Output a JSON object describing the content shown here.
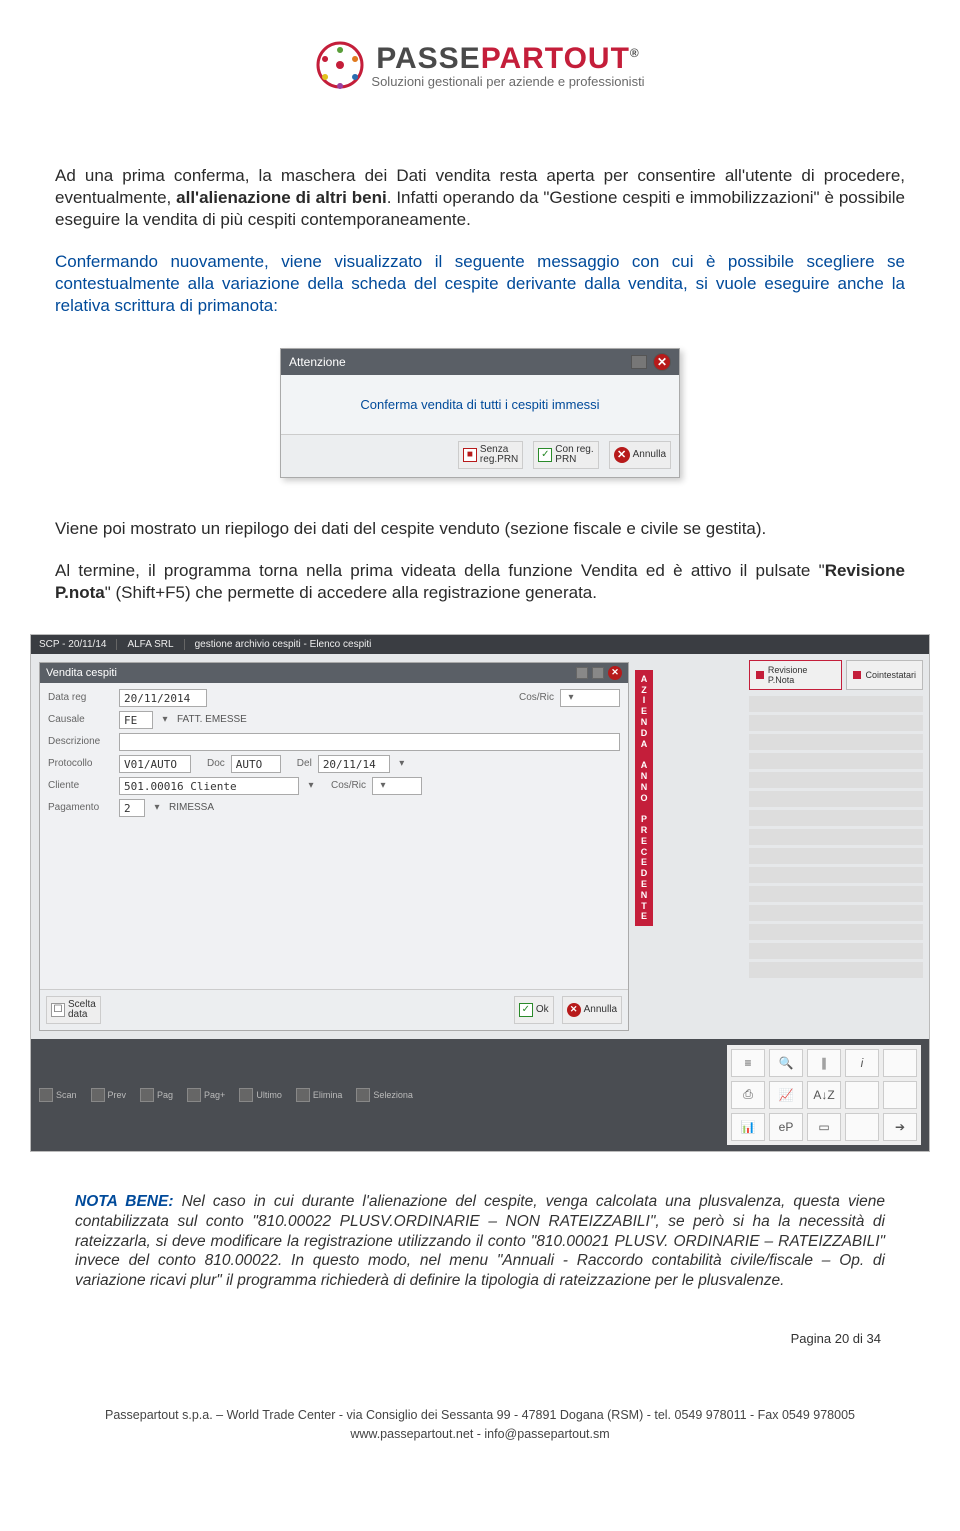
{
  "header": {
    "brand_dark": "PASSE",
    "brand_red": "PARTOUT",
    "reg": "®",
    "sub": "Soluzioni gestionali per aziende e professionisti"
  },
  "para1": "Ad una prima conferma, la maschera dei Dati vendita resta aperta per consentire all'utente di procedere, eventualmente, ",
  "para1_bold": "all'alienazione di altri beni",
  "para1_after": ". Infatti operando da \"Gestione cespiti e immobilizzazioni\" è possibile eseguire la vendita di più cespiti contemporaneamente.",
  "para2": "Confermando nuovamente, viene visualizzato il seguente messaggio con cui è possibile scegliere se contestualmente alla variazione della scheda del cespite derivante dalla vendita, si vuole eseguire anche la relativa scrittura di primanota:",
  "dialog": {
    "title": "Attenzione",
    "body": "Conferma vendita di tutti i cespiti immessi",
    "btn1a": "Senza",
    "btn1b": "reg.PRN",
    "btn2a": "Con reg.",
    "btn2b": "PRN",
    "btn3": "Annulla"
  },
  "para3a": "Viene poi mostrato un riepilogo dei dati del cespite venduto (sezione fiscale e civile se gestita).",
  "para3b_pre": "Al termine, il programma torna nella prima videata della funzione Vendita ed è attivo il pulsate \"",
  "para3b_bold": "Revisione P.nota",
  "para3b_post": "\" (Shift+F5) che permette di accedere alla registrazione generata.",
  "app": {
    "title1": "SCP - 20/11/14",
    "title2": "ALFA SRL",
    "title3": "gestione archivio cespiti  - Elenco cespiti",
    "side_btn1": "Revisione P.Nota",
    "side_btn2": "Cointestatari",
    "form_title": "Vendita cespiti",
    "f_datareg_l": "Data reg",
    "f_datareg_v": "20/11/2014",
    "f_cosric": "Cos/Ric",
    "f_causale_l": "Causale",
    "f_causale_v": "FE",
    "f_causale_d": "FATT. EMESSE",
    "f_descr_l": "Descrizione",
    "f_proto_l": "Protocollo",
    "f_proto_v": "V01/AUTO",
    "f_doc_l": "Doc",
    "f_doc_v": "AUTO",
    "f_del_l": "Del",
    "f_del_v": "20/11/14",
    "f_cliente_l": "Cliente",
    "f_cliente_v": "501.00016 Cliente",
    "f_pag_l": "Pagamento",
    "f_pag_v": "2",
    "f_pag_d": "RIMESSA",
    "foot_scelta": "Scelta",
    "foot_data": "data",
    "foot_ok": "Ok",
    "foot_ann": "Annulla",
    "vstrip": "AZIENDA ANNO PRECEDENTE",
    "bb": [
      "Scan",
      "Prev",
      "Pag",
      "Pag+",
      "Ultimo",
      "Elimina",
      "Seleziona"
    ]
  },
  "nota_label": "NOTA BENE:",
  "nota": " Nel caso in cui durante l'alienazione del cespite, venga calcolata una plusvalenza, questa viene contabilizzata sul conto \"810.00022 PLUSV.ORDINARIE – NON RATEIZZABILI\", se però si ha la necessità di rateizzarla, si deve modificare la registrazione utilizzando il conto \"810.00021 PLUSV. ORDINARIE – RATEIZZABILI\" invece del conto 810.00022. In questo modo, nel menu \"Annuali - Raccordo contabilità civile/fiscale – Op. di variazione ricavi plur\" il programma richiederà di definire la tipologia di rateizzazione per le plusvalenze.",
  "pagenum": "Pagina 20 di 34",
  "footer1": "Passepartout s.p.a. – World Trade Center - via Consiglio dei Sessanta 99 - 47891 Dogana (RSM) - tel. 0549 978011 - Fax 0549 978005",
  "footer2": "www.passepartout.net - info@passepartout.sm"
}
